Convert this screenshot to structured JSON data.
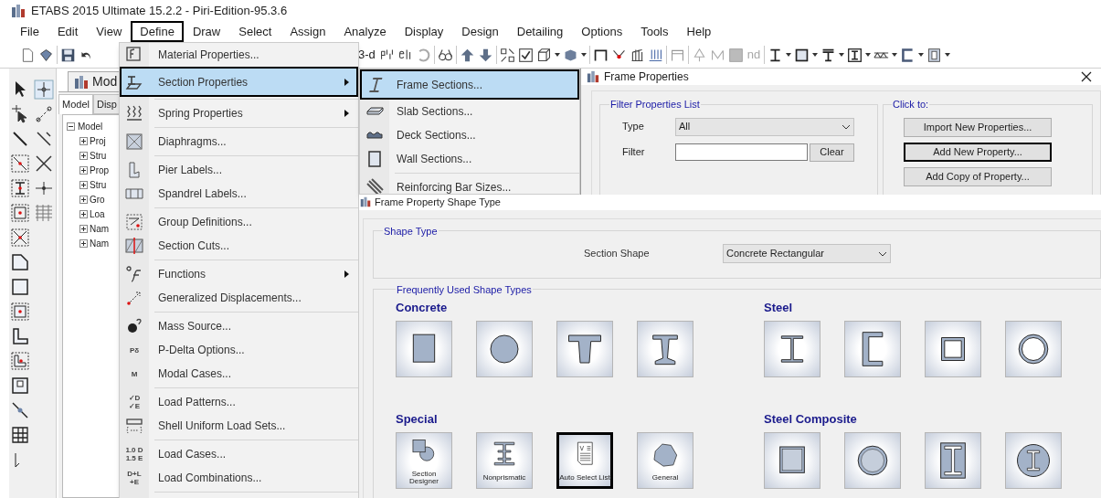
{
  "window": {
    "title": "ETABS 2015 Ultimate 15.2.2 - Piri-Edition-95.3.6"
  },
  "menu_bar": [
    {
      "label": "File",
      "outlined": false
    },
    {
      "label": "Edit",
      "outlined": false
    },
    {
      "label": "View",
      "outlined": false
    },
    {
      "label": "Define",
      "outlined": true
    },
    {
      "label": "Draw",
      "outlined": false
    },
    {
      "label": "Select",
      "outlined": false
    },
    {
      "label": "Assign",
      "outlined": false
    },
    {
      "label": "Analyze",
      "outlined": false
    },
    {
      "label": "Display",
      "outlined": false
    },
    {
      "label": "Design",
      "outlined": false
    },
    {
      "label": "Detailing",
      "outlined": false
    },
    {
      "label": "Options",
      "outlined": false
    },
    {
      "label": "Tools",
      "outlined": false
    },
    {
      "label": "Help",
      "outlined": false
    }
  ],
  "toolbar": {
    "labels": [
      {
        "text": "3-d",
        "disabled": false
      },
      {
        "text": "nd",
        "disabled": true
      }
    ]
  },
  "model_explorer": {
    "pane_tab": "Mod",
    "tabs": [
      {
        "label": "Model",
        "selected": true
      },
      {
        "label": "Disp",
        "selected": false
      }
    ],
    "tree": {
      "label": "Model",
      "expanded": true,
      "children": [
        {
          "label": "Proj",
          "expanded": false
        },
        {
          "label": "Stru",
          "expanded": false
        },
        {
          "label": "Prop",
          "expanded": false
        },
        {
          "label": "Stru",
          "expanded": false
        },
        {
          "label": "Gro",
          "expanded": false
        },
        {
          "label": "Loa",
          "expanded": false
        },
        {
          "label": "Nam",
          "expanded": false
        },
        {
          "label": "Nam",
          "expanded": false
        }
      ]
    }
  },
  "define_menu": {
    "groups": [
      [
        {
          "label": "Material Properties...",
          "submenu": false,
          "selected": false,
          "outlined": false
        },
        {
          "label": "Section Properties",
          "submenu": true,
          "selected": true,
          "outlined": true
        }
      ],
      [
        {
          "label": "Spring Properties",
          "submenu": true,
          "selected": false,
          "outlined": false
        }
      ],
      [
        {
          "label": "Diaphragms...",
          "submenu": false,
          "selected": false,
          "outlined": false
        }
      ],
      [
        {
          "label": "Pier Labels...",
          "submenu": false,
          "selected": false,
          "outlined": false
        },
        {
          "label": "Spandrel Labels...",
          "submenu": false,
          "selected": false,
          "outlined": false
        }
      ],
      [
        {
          "label": "Group Definitions...",
          "submenu": false,
          "selected": false,
          "outlined": false
        },
        {
          "label": "Section Cuts...",
          "submenu": false,
          "selected": false,
          "outlined": false
        }
      ],
      [
        {
          "label": "Functions",
          "submenu": true,
          "selected": false,
          "outlined": false
        },
        {
          "label": "Generalized Displacements...",
          "submenu": false,
          "selected": false,
          "outlined": false
        }
      ],
      [
        {
          "label": "Mass Source...",
          "submenu": false,
          "selected": false,
          "outlined": false
        },
        {
          "label": "P-Delta Options...",
          "submenu": false,
          "selected": false,
          "outlined": false,
          "icon_text": "Pδ"
        },
        {
          "label": "Modal Cases...",
          "submenu": false,
          "selected": false,
          "outlined": false,
          "icon_text": "M"
        }
      ],
      [
        {
          "label": "Load Patterns...",
          "submenu": false,
          "selected": false,
          "outlined": false,
          "icon_text": "✓D\n✓E"
        },
        {
          "label": "Shell Uniform Load Sets...",
          "submenu": false,
          "selected": false,
          "outlined": false
        }
      ],
      [
        {
          "label": "Load Cases...",
          "submenu": false,
          "selected": false,
          "outlined": false,
          "icon_text": "1.0 D\n1.5 E"
        },
        {
          "label": "Load Combinations...",
          "submenu": false,
          "selected": false,
          "outlined": false,
          "icon_text": "D+L\n+E"
        }
      ]
    ]
  },
  "section_submenu": {
    "groups": [
      [
        {
          "label": "Frame Sections...",
          "selected": true,
          "outlined": true
        },
        {
          "label": "Slab Sections...",
          "selected": false,
          "outlined": false
        },
        {
          "label": "Deck Sections...",
          "selected": false,
          "outlined": false
        },
        {
          "label": "Wall Sections...",
          "selected": false,
          "outlined": false
        }
      ],
      [
        {
          "label": "Reinforcing Bar Sizes...",
          "selected": false,
          "outlined": false
        }
      ]
    ]
  },
  "frame_properties": {
    "title": "Frame Properties",
    "filter_group": "Filter Properties List",
    "type_label": "Type",
    "type_value": "All",
    "filter_label": "Filter",
    "clear_button": "Clear",
    "click_group": "Click to:",
    "buttons": [
      {
        "label": "Import New Properties...",
        "outlined": false
      },
      {
        "label": "Add New Property...",
        "outlined": true
      },
      {
        "label": "Add Copy of Property...",
        "outlined": false
      }
    ]
  },
  "shape_type_dialog": {
    "title": "Frame Property Shape Type",
    "shape_type_group": "Shape Type",
    "section_shape_label": "Section Shape",
    "section_shape_value": "Concrete Rectangular",
    "frequent_group": "Frequently Used Shape Types",
    "categories": [
      {
        "name": "Concrete",
        "shapes": [
          {
            "kind": "rectangle",
            "outlined": false
          },
          {
            "kind": "circle",
            "outlined": false
          },
          {
            "kind": "tee",
            "outlined": false
          },
          {
            "kind": "i_section",
            "outlined": false
          }
        ]
      },
      {
        "name": "Steel",
        "shapes": [
          {
            "kind": "steel_i",
            "outlined": false
          },
          {
            "kind": "channel",
            "outlined": false
          },
          {
            "kind": "box",
            "outlined": false
          },
          {
            "kind": "pipe",
            "outlined": false
          }
        ]
      },
      {
        "name": "Special",
        "shapes": [
          {
            "kind": "section_designer",
            "caption": "Section Designer",
            "outlined": false
          },
          {
            "kind": "nonprismatic",
            "caption": "Nonprismatic",
            "outlined": false
          },
          {
            "kind": "auto_select",
            "caption": "Auto Select List",
            "outlined": true
          },
          {
            "kind": "general",
            "caption": "General",
            "outlined": false
          }
        ]
      },
      {
        "name": "Steel Composite",
        "shapes": [
          {
            "kind": "filled_box",
            "outlined": false
          },
          {
            "kind": "filled_pipe",
            "outlined": false
          },
          {
            "kind": "encased_i",
            "outlined": false
          },
          {
            "kind": "encased_circle_i",
            "outlined": false
          }
        ]
      }
    ]
  }
}
